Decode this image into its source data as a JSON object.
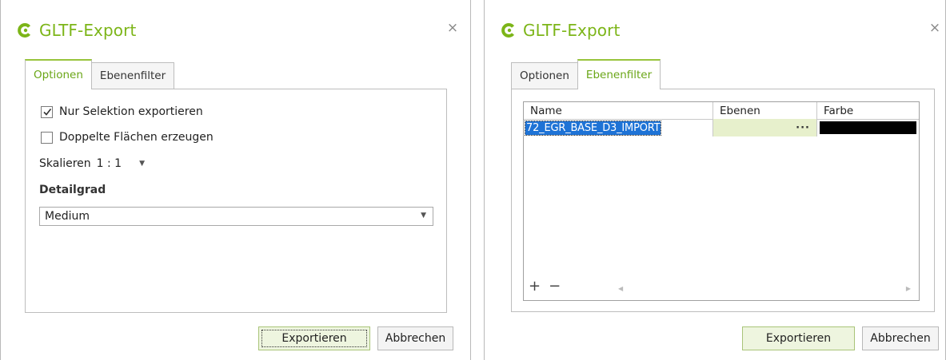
{
  "dialogs": [
    {
      "title": "GLTF-Export",
      "close_label": "×",
      "tabs": [
        {
          "label": "Optionen"
        },
        {
          "label": "Ebenenfilter"
        }
      ],
      "options": {
        "export_selection": {
          "label": "Nur Selektion exportieren",
          "checked": true
        },
        "double_faces": {
          "label": "Doppelte Flächen erzeugen",
          "checked": false
        },
        "scale_label": "Skalieren",
        "scale_value": "1 : 1",
        "detail_heading": "Detailgrad",
        "detail_value": "Medium"
      },
      "buttons": {
        "export": "Exportieren",
        "cancel": "Abbrechen"
      }
    },
    {
      "title": "GLTF-Export",
      "close_label": "×",
      "tabs": [
        {
          "label": "Optionen"
        },
        {
          "label": "Ebenenfilter"
        }
      ],
      "layer_filter": {
        "columns": [
          "Name",
          "Ebenen",
          "Farbe"
        ],
        "rows": [
          {
            "name": "72_EGR_BASE_D3_IMPORT",
            "levels": "···",
            "color": "#000000"
          }
        ],
        "add_label": "+",
        "remove_label": "−"
      },
      "buttons": {
        "export": "Exportieren",
        "cancel": "Abbrechen"
      }
    }
  ],
  "colors": {
    "accent": "#7cb518",
    "selection": "#1e73d6",
    "level_cell": "#e7f0cc"
  },
  "icons": {
    "logo": "brand-c-logo-icon",
    "close": "close-icon",
    "checkbox": "check-icon",
    "dropdown": "chevron-down-icon"
  }
}
